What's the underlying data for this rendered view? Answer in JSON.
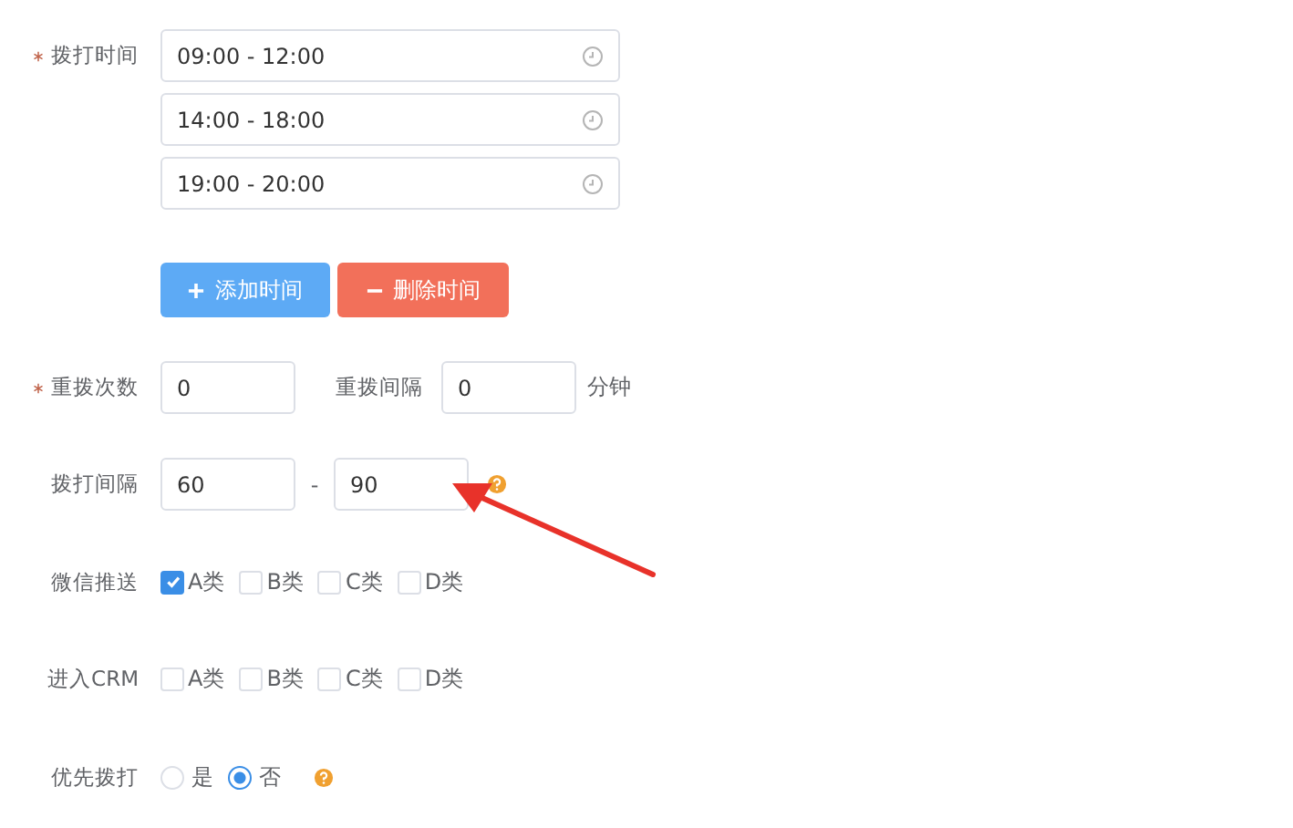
{
  "call_times": {
    "label": "拨打时间",
    "required": true,
    "ranges": [
      "09:00 - 12:00",
      "14:00 - 18:00",
      "19:00 - 20:00"
    ]
  },
  "buttons": [
    {
      "label": "添加时间",
      "kind": "add"
    },
    {
      "label": "删除时间",
      "kind": "delete"
    }
  ],
  "retry": {
    "count_label": "重拨次数",
    "required": true,
    "count": "0",
    "interval_label": "重拨间隔",
    "interval": "0",
    "unit": "分钟"
  },
  "call_interval": {
    "label": "拨打间隔",
    "min": "60",
    "separator": "-",
    "max": "90",
    "help": true
  },
  "wechat_push": {
    "label": "微信推送",
    "options": [
      {
        "label": "A类",
        "checked": true
      },
      {
        "label": "B类",
        "checked": false
      },
      {
        "label": "C类",
        "checked": false
      },
      {
        "label": "D类",
        "checked": false
      }
    ]
  },
  "crm": {
    "label": "进入CRM",
    "options": [
      {
        "label": "A类",
        "checked": false
      },
      {
        "label": "B类",
        "checked": false
      },
      {
        "label": "C类",
        "checked": false
      },
      {
        "label": "D类",
        "checked": false
      }
    ]
  },
  "priority": {
    "label": "优先拨打",
    "options": [
      {
        "label": "是",
        "selected": false
      },
      {
        "label": "否",
        "selected": true
      }
    ],
    "help": true
  },
  "annotation": {
    "kind": "arrow"
  }
}
